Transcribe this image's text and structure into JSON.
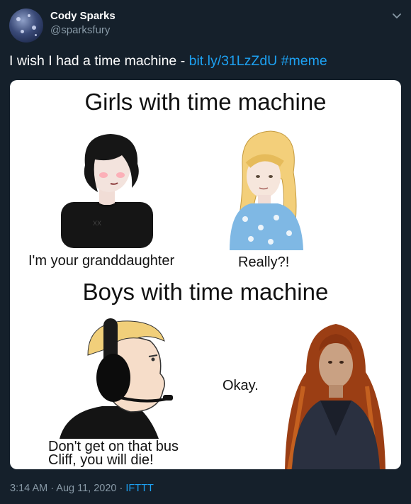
{
  "author": {
    "name": "Cody Sparks",
    "handle": "@sparksfury"
  },
  "tweet": {
    "text": "I wish I had a time machine - ",
    "link": "bit.ly/31LzZdU",
    "hashtag": "#meme"
  },
  "meme": {
    "heading1": "Girls with time machine",
    "caption1a": "I'm your granddaughter",
    "caption1b": "Really?!",
    "heading2": "Boys with time machine",
    "caption2a_line1": "Don't get on that bus",
    "caption2a_line2": "Cliff, you will die!",
    "caption2b": "Okay."
  },
  "meta": {
    "time": "3:14 AM",
    "sep1": " · ",
    "date": "Aug 11, 2020",
    "sep2": " · ",
    "source": "IFTTT"
  },
  "colors": {
    "background": "#15202b",
    "link": "#1da1f2",
    "secondary": "#8899a6"
  }
}
